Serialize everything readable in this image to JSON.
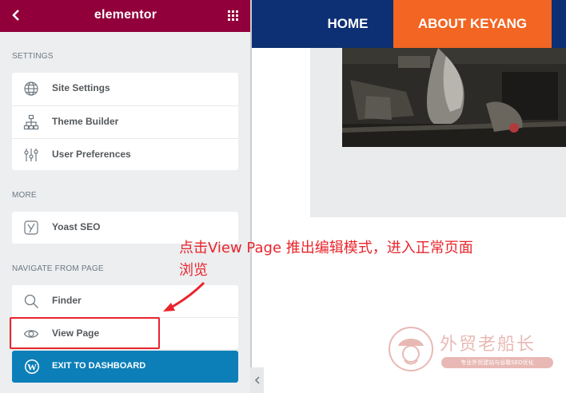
{
  "sidebar": {
    "logo": "elementor",
    "settings_title": "SETTINGS",
    "settings_items": [
      {
        "label": "Site Settings",
        "icon": "globe-icon"
      },
      {
        "label": "Theme Builder",
        "icon": "sitemap-icon"
      },
      {
        "label": "User Preferences",
        "icon": "sliders-icon"
      }
    ],
    "more_title": "MORE",
    "more_items": [
      {
        "label": "Yoast SEO",
        "icon": "yoast-icon"
      }
    ],
    "navigate_title": "NAVIGATE FROM PAGE",
    "navigate_items": [
      {
        "label": "Finder",
        "icon": "search-icon"
      },
      {
        "label": "View Page",
        "icon": "eye-icon"
      }
    ],
    "exit_label": "EXIT TO DASHBOARD"
  },
  "preview": {
    "nav": {
      "home": "HOME",
      "about": "ABOUT KEYANG"
    }
  },
  "annotation": {
    "line1": "点击View Page 推出编辑模式，进入正常页面",
    "line2": "浏览"
  },
  "watermark": {
    "title": "外贸老船长",
    "subtitle": "专业外贸建站与谷歌SEO优化"
  },
  "colors": {
    "header": "#92003b",
    "exit_button": "#0c7fb8",
    "nav_bg": "#0d2f73",
    "nav_active": "#f26522",
    "annotation": "#e8252c"
  }
}
